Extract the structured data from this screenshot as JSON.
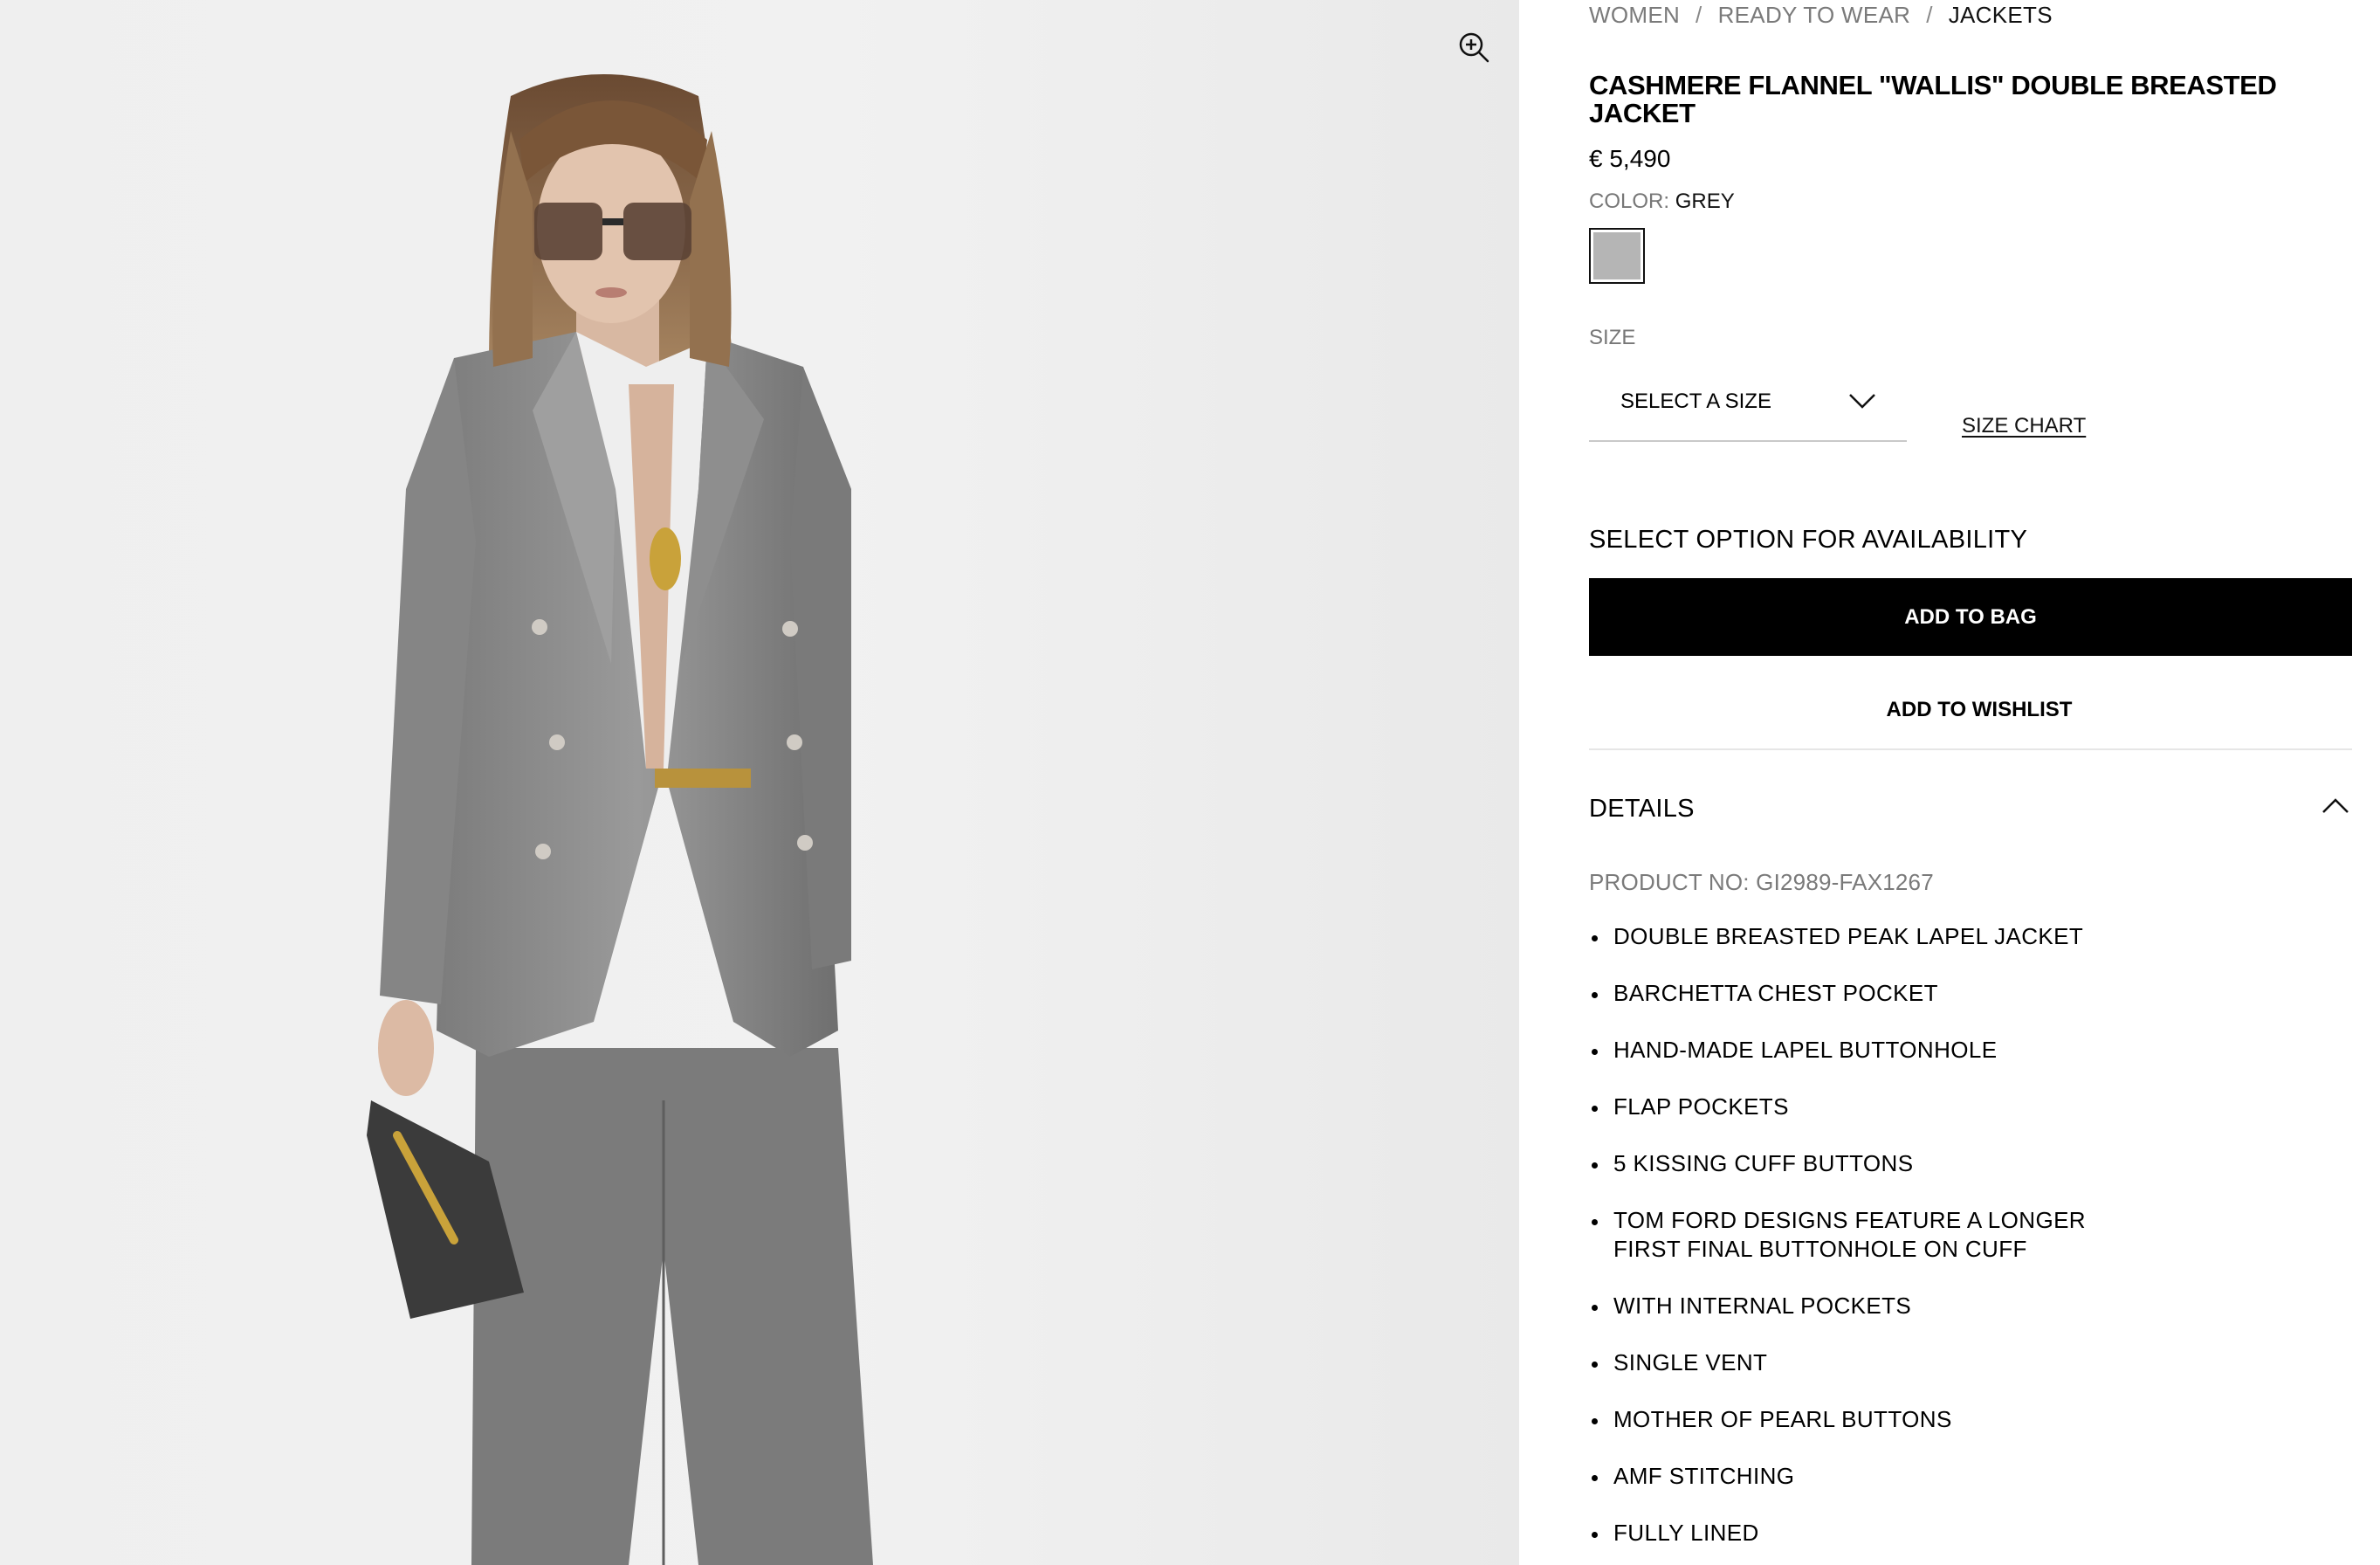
{
  "breadcrumb": {
    "items": [
      "WOMEN",
      "READY TO WEAR",
      "JACKETS"
    ],
    "separator": "/"
  },
  "product": {
    "title": "CASHMERE FLANNEL \"WALLIS\" DOUBLE BREASTED JACKET",
    "price": "€ 5,490",
    "color_label": "COLOR:",
    "color_value": "GREY",
    "swatch_color": "#b5b5b5"
  },
  "size": {
    "label": "SIZE",
    "select_label": "SELECT A SIZE",
    "size_chart": "SIZE CHART"
  },
  "availability_text": "SELECT OPTION FOR AVAILABILITY",
  "actions": {
    "add_to_bag": "ADD TO BAG",
    "add_to_wishlist": "ADD TO WISHLIST"
  },
  "details": {
    "title": "DETAILS",
    "product_no": "PRODUCT NO: GI2989-FAX1267",
    "bullets": [
      "DOUBLE BREASTED PEAK LAPEL JACKET",
      "BARCHETTA CHEST POCKET",
      "HAND-MADE LAPEL BUTTONHOLE",
      "FLAP POCKETS",
      "5 KISSING CUFF BUTTONS",
      "TOM FORD DESIGNS FEATURE A LONGER FIRST FINAL BUTTONHOLE ON CUFF",
      "WITH INTERNAL POCKETS",
      "SINGLE VENT",
      "MOTHER OF PEARL BUTTONS",
      "AMF STITCHING",
      "FULLY LINED"
    ]
  },
  "icons": {
    "zoom": "zoom-in-icon",
    "size_dropdown": "chevron-down-icon",
    "details_toggle": "chevron-up-icon"
  },
  "colors": {
    "button_bg": "#000000",
    "button_text": "#ffffff",
    "muted_text": "#7a7a7a",
    "jacket_grey": "#8c8c8c"
  }
}
